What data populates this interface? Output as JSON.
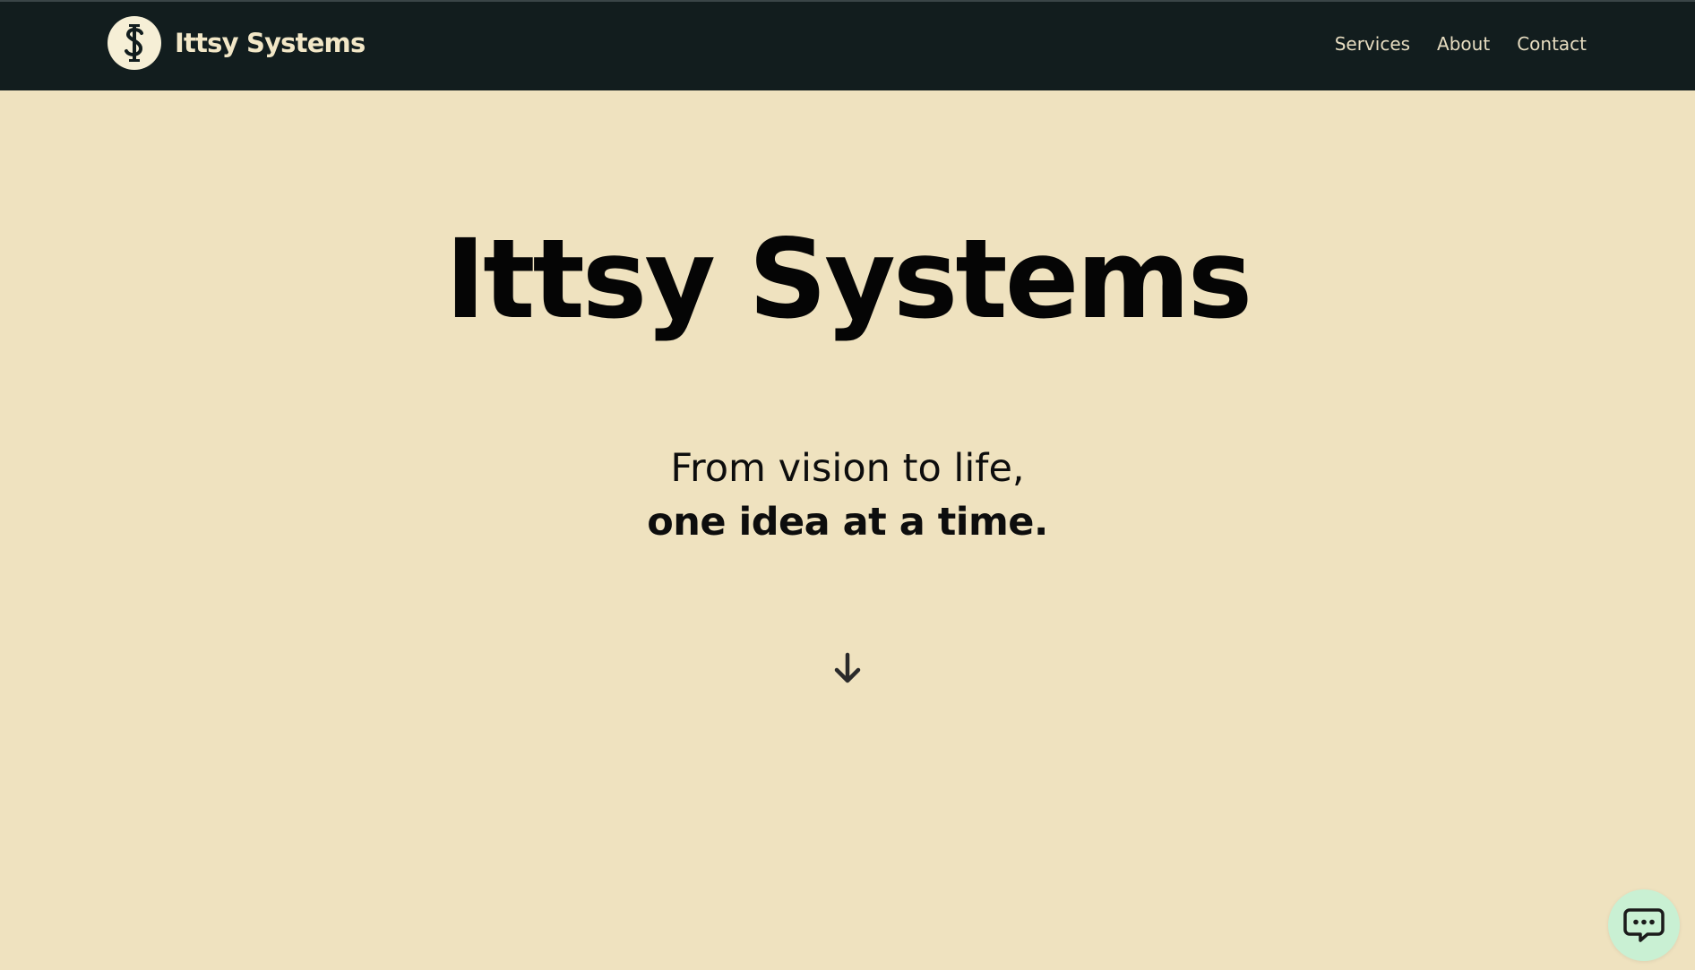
{
  "header": {
    "brand_name": "Ittsy Systems",
    "logo_icon": "dollar-i-monogram-icon",
    "nav": [
      {
        "label": "Services"
      },
      {
        "label": "About"
      },
      {
        "label": "Contact"
      }
    ]
  },
  "hero": {
    "title": "Ittsy Systems",
    "tagline_line1": "From vision to life,",
    "tagline_line2": "one idea at a time.",
    "scroll_icon": "arrow-down-icon"
  },
  "chat": {
    "icon": "chat-bubble-icon"
  },
  "colors": {
    "background": "#efe2bf",
    "navbar": "#121d1e",
    "nav_text": "#e6dcc0",
    "chat_button": "#c9f0d3"
  }
}
